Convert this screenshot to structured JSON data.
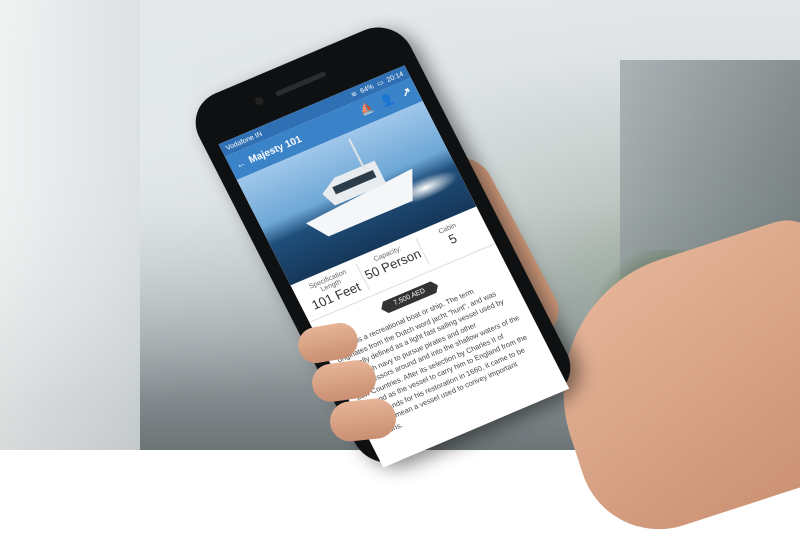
{
  "status": {
    "carrier": "Vodafone IN",
    "battery": "64%",
    "time": "20:14"
  },
  "app_bar": {
    "back_icon": "back-arrow-icon",
    "title": "Majesty 101",
    "icons": [
      "sailboat-icon",
      "user-icon",
      "share-icon"
    ]
  },
  "specs": [
    {
      "label": "Specification Length",
      "value": "101 Feet"
    },
    {
      "label": "Capacity:",
      "value": "50 Person"
    },
    {
      "label": "Cabin",
      "value": "5"
    }
  ],
  "price": "7,500 AED",
  "description": "A yacht is a recreational boat or ship. The term originates from the Dutch word jacht \"hunt\", and was originally defined as a light fast sailing vessel used by the Dutch navy to pursue pirates and other transgressors around and into the shallow waters of the Low Countries. After its selection by Charles II of England as the vessel to carry him to England from the Netherlands for his restoration in 1660, it came to be used to mean a vessel used to convey important persons."
}
